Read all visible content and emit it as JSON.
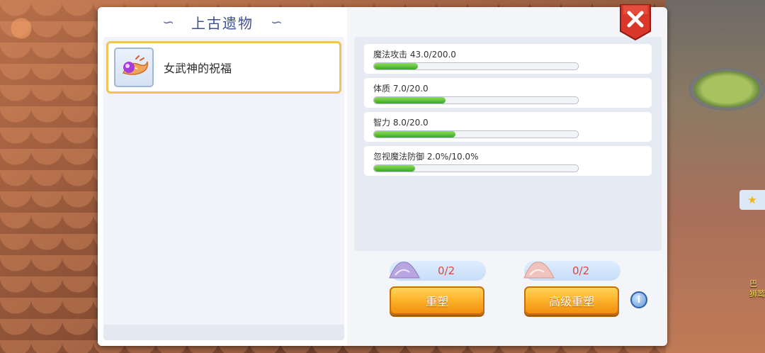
{
  "panel": {
    "title": "上古遗物",
    "title_decor_left": "∽",
    "title_decor_right": "∽"
  },
  "relic_list": [
    {
      "name": "女武神的祝福",
      "selected": true,
      "icon": "valkyrie-wing-icon"
    }
  ],
  "stats": [
    {
      "label": "魔法攻击 43.0/200.0",
      "fill": 0.215
    },
    {
      "label": "体质 7.0/20.0",
      "fill": 0.35
    },
    {
      "label": "智力 8.0/20.0",
      "fill": 0.4
    },
    {
      "label": "忽视魔法防御 2.0%/10.0%",
      "fill": 0.2
    }
  ],
  "costs": [
    {
      "text": "0/2",
      "icon": "purple-powder-icon"
    },
    {
      "text": "0/2",
      "icon": "pink-powder-icon"
    }
  ],
  "buttons": {
    "reshape": "重塑",
    "advanced_reshape": "高级重塑",
    "info": "i",
    "close": "✕"
  },
  "world": {
    "fav_icon": "★",
    "side_text": "巴\n狮鹫"
  },
  "colors": {
    "title": "#3e4f93",
    "selected_border": "#f2c35a",
    "bar_fill": "#3aa824",
    "cost_text": "#e0463c",
    "button_orange": "#ffb52e",
    "close_red": "#d8372a"
  }
}
